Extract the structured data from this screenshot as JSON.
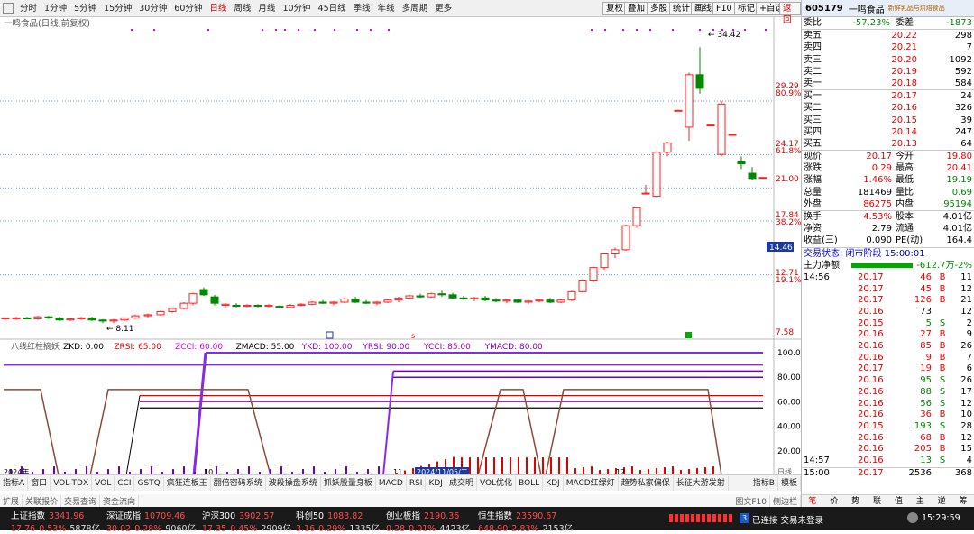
{
  "topbar": {
    "periods": [
      "分时",
      "1分钟",
      "5分钟",
      "15分钟",
      "30分钟",
      "60分钟",
      "日线",
      "周线",
      "月线",
      "10分钟",
      "45日线",
      "季线",
      "年线",
      "多周期",
      "更多"
    ],
    "active_index": 6,
    "right_buttons": [
      "复权",
      "叠加",
      "多股",
      "统计",
      "画线",
      "F10",
      "标记",
      "+自选",
      "返回"
    ]
  },
  "chart": {
    "title": "一鸣食品(日线,前复权)",
    "price_labels": [
      {
        "v": "34.42"
      },
      {
        "v": "29.29"
      },
      {
        "v": "80.9%"
      },
      {
        "v": "24.17"
      },
      {
        "v": "61.8%"
      },
      {
        "v": "21.00"
      },
      {
        "v": "17.84"
      },
      {
        "v": "38.2%"
      },
      {
        "v": "14.46"
      },
      {
        "v": "12.71"
      },
      {
        "v": "19.1%"
      },
      {
        "v": "7.58"
      }
    ],
    "high_label": "34.42",
    "low_label": "8.11",
    "colors": {
      "up": "#ff2020",
      "down": "#008800",
      "bg": "#ffffff",
      "grid": "#6aa0e0"
    }
  },
  "indicator": {
    "name": "八线红柱摘妖",
    "params": [
      {
        "label": "ZKD: 0.00",
        "color": "#000000"
      },
      {
        "label": "ZRSI: 65.00",
        "color": "#e00000"
      },
      {
        "label": "ZCCI: 60.00",
        "color": "#e000e0"
      },
      {
        "label": "ZMACD: 55.00",
        "color": "#000000"
      },
      {
        "label": "YKD: 100.00",
        "color": "#a000c0"
      },
      {
        "label": "YRSI: 90.00",
        "color": "#8000ff"
      },
      {
        "label": "YCCI: 85.00",
        "color": "#a000a0"
      },
      {
        "label": "YMACD: 80.00",
        "color": "#8000c0"
      }
    ],
    "axis": [
      "100.0",
      "80.00",
      "60.00",
      "40.00",
      "20.00"
    ],
    "months": [
      "2024年",
      "10",
      "11",
      "2024/11/05/二",
      "12"
    ],
    "unit": "日线"
  },
  "bottom_tabs": [
    "指标A",
    "窗口",
    "VOL-TDX",
    "VOL",
    "CCI",
    "GSTQ",
    "疯狂连板王",
    "翻倍密码系统",
    "波段操盘系统",
    "抓妖股量身板",
    "MACD",
    "RSI",
    "KDJ",
    "成交明",
    "VOL优化",
    "BOLL",
    "KDJ",
    "MACD红绿灯",
    "趋势私家偏保",
    "长征大游发射"
  ],
  "bottom_right": [
    "指标B",
    "模板"
  ],
  "sub_tabs": [
    "扩展",
    "关联报价",
    "交易查询",
    "资金流向"
  ],
  "sub_right": [
    "图文F10",
    "侧边栏"
  ],
  "right_panel": {
    "code": "605179",
    "name": "一鸣食品",
    "tag": "新鲜乳品与烘焙食品",
    "weibi_label": "委比",
    "weibi": "-57.23%",
    "weicha_label": "委差",
    "weicha": "-1873",
    "sells": [
      {
        "l": "卖五",
        "p": "20.22",
        "v": "298"
      },
      {
        "l": "卖四",
        "p": "20.21",
        "v": "7"
      },
      {
        "l": "卖三",
        "p": "20.20",
        "v": "1092"
      },
      {
        "l": "卖二",
        "p": "20.19",
        "v": "592"
      },
      {
        "l": "卖一",
        "p": "20.18",
        "v": "584"
      }
    ],
    "buys": [
      {
        "l": "买一",
        "p": "20.17",
        "v": "24"
      },
      {
        "l": "买二",
        "p": "20.16",
        "v": "326"
      },
      {
        "l": "买三",
        "p": "20.15",
        "v": "39"
      },
      {
        "l": "买四",
        "p": "20.14",
        "v": "247"
      },
      {
        "l": "买五",
        "p": "20.13",
        "v": "64"
      }
    ],
    "stats": [
      {
        "a": "现价",
        "b": "20.17",
        "c": "今开",
        "d": "19.80"
      },
      {
        "a": "涨跌",
        "b": "0.29",
        "c": "最高",
        "d": "20.41"
      },
      {
        "a": "涨幅",
        "b": "1.46%",
        "c": "最低",
        "d": "19.19"
      },
      {
        "a": "总量",
        "b": "181469",
        "c": "量比",
        "d": "0.69"
      },
      {
        "a": "外盘",
        "b": "86275",
        "c": "内盘",
        "d": "95194"
      }
    ],
    "stats2": [
      {
        "a": "换手",
        "b": "4.53%",
        "c": "股本",
        "d": "4.01亿"
      },
      {
        "a": "净资",
        "b": "2.79",
        "c": "流通",
        "d": "4.01亿"
      },
      {
        "a": "收益(三)",
        "b": "0.090",
        "c": "PE(动)",
        "d": "164.4"
      }
    ],
    "trade_state": "交易状态: 闭市阶段 15:00:01",
    "main_flow_label": "主力净额",
    "main_flow": "-612.7万",
    "main_flow_pct": "-2%",
    "ticks": [
      {
        "t": "14:56",
        "p": "20.17",
        "v": "46",
        "s": "B",
        "n": "11"
      },
      {
        "t": "",
        "p": "20.17",
        "v": "45",
        "s": "B",
        "n": "12"
      },
      {
        "t": "",
        "p": "20.17",
        "v": "126",
        "s": "B",
        "n": "21"
      },
      {
        "t": "",
        "p": "20.16",
        "v": "73",
        "s": "",
        "n": "12"
      },
      {
        "t": "",
        "p": "20.15",
        "v": "5",
        "s": "S",
        "n": "2"
      },
      {
        "t": "",
        "p": "20.16",
        "v": "27",
        "s": "B",
        "n": "9"
      },
      {
        "t": "",
        "p": "20.16",
        "v": "85",
        "s": "B",
        "n": "26"
      },
      {
        "t": "",
        "p": "20.16",
        "v": "9",
        "s": "B",
        "n": "7"
      },
      {
        "t": "",
        "p": "20.17",
        "v": "19",
        "s": "B",
        "n": "6"
      },
      {
        "t": "",
        "p": "20.16",
        "v": "95",
        "s": "S",
        "n": "26"
      },
      {
        "t": "",
        "p": "20.16",
        "v": "88",
        "s": "S",
        "n": "17"
      },
      {
        "t": "",
        "p": "20.16",
        "v": "56",
        "s": "S",
        "n": "12"
      },
      {
        "t": "",
        "p": "20.16",
        "v": "36",
        "s": "B",
        "n": "10"
      },
      {
        "t": "",
        "p": "20.15",
        "v": "193",
        "s": "S",
        "n": "28"
      },
      {
        "t": "",
        "p": "20.16",
        "v": "68",
        "s": "B",
        "n": "12"
      },
      {
        "t": "",
        "p": "20.16",
        "v": "205",
        "s": "B",
        "n": "15"
      },
      {
        "t": "14:57",
        "p": "20.16",
        "v": "13",
        "s": "S",
        "n": "4"
      },
      {
        "t": "15:00",
        "p": "20.17",
        "v": "2536",
        "s": "",
        "n": "368"
      }
    ],
    "tabs": [
      "笔",
      "价",
      "势",
      "联",
      "值",
      "主",
      "逆",
      "筹"
    ]
  },
  "status": {
    "indices": [
      {
        "name": "上证指数",
        "value": "3341.96",
        "chg": "17.76",
        "pct": "0.53%",
        "amt": "5878亿"
      },
      {
        "name": "深证成指",
        "value": "10709.46",
        "chg": "30.02",
        "pct": "0.28%",
        "amt": "9060亿"
      },
      {
        "name": "沪深300",
        "value": "3902.57",
        "chg": "17.35",
        "pct": "0.45%",
        "amt": "2909亿"
      },
      {
        "name": "科创50",
        "value": "1083.82",
        "chg": "3.16",
        "pct": "0.29%",
        "amt": "1335亿"
      },
      {
        "name": "创业板指",
        "value": "2190.36",
        "chg": "0.28",
        "pct": "0.01%",
        "amt": "4423亿"
      },
      {
        "name": "恒生指数",
        "value": "23590.67",
        "chg": "648.90",
        "pct": "2.83%",
        "amt": "2153亿"
      }
    ],
    "conn": "已连接 交易未登录",
    "conn_num": "3",
    "time": "15:29:59"
  }
}
